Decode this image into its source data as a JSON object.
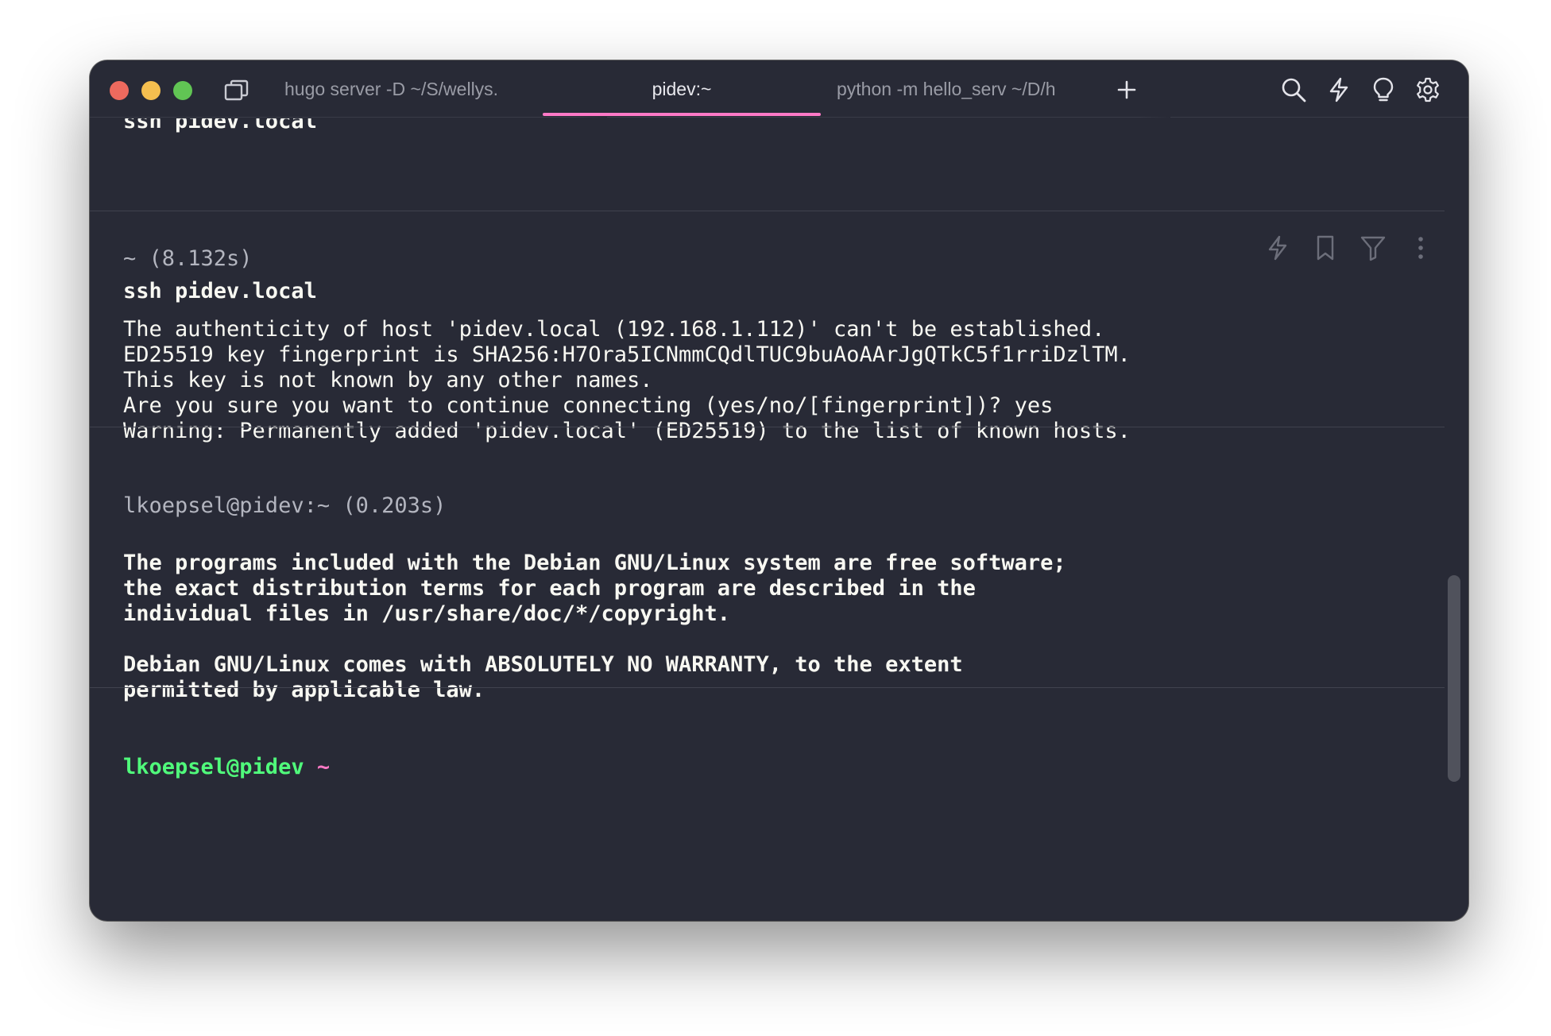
{
  "window": {
    "tabs": [
      {
        "label": "hugo server -D ~/S/wellys."
      },
      {
        "label": "pidev:~"
      },
      {
        "label": "python -m hello_serv ~/D/h"
      }
    ],
    "toolbar_icons": [
      "search-icon",
      "lightning-icon",
      "lightbulb-icon",
      "gear-icon"
    ]
  },
  "terminal": {
    "prev_command_partial": "ssh pidev.local",
    "block1": {
      "header": "~ (8.132s)",
      "command": "ssh pidev.local",
      "output": [
        "The authenticity of host 'pidev.local (192.168.1.112)' can't be established.",
        "ED25519 key fingerprint is SHA256:H7Ora5ICNmmCQdlTUC9buAoAArJgQTkC5f1rriDzlTM.",
        "This key is not known by any other names.",
        "Are you sure you want to continue connecting (yes/no/[fingerprint])? yes",
        "Warning: Permanently added 'pidev.local' (ED25519) to the list of known hosts."
      ]
    },
    "block2": {
      "header": "lkoepsel@pidev:~ (0.203s)",
      "output": [
        "The programs included with the Debian GNU/Linux system are free software;",
        "the exact distribution terms for each program are described in the",
        "individual files in /usr/share/doc/*/copyright.",
        "Debian GNU/Linux comes with ABSOLUTELY NO WARRANTY, to the extent",
        "permitted by applicable law."
      ]
    },
    "prompt": {
      "user": "lkoepsel@pidev",
      "path": "~"
    }
  },
  "colors": {
    "background": "#282a36",
    "active_tab_underline": "#ff79c6",
    "prompt_user": "#50fa7b",
    "prompt_path": "#ff79c6"
  }
}
